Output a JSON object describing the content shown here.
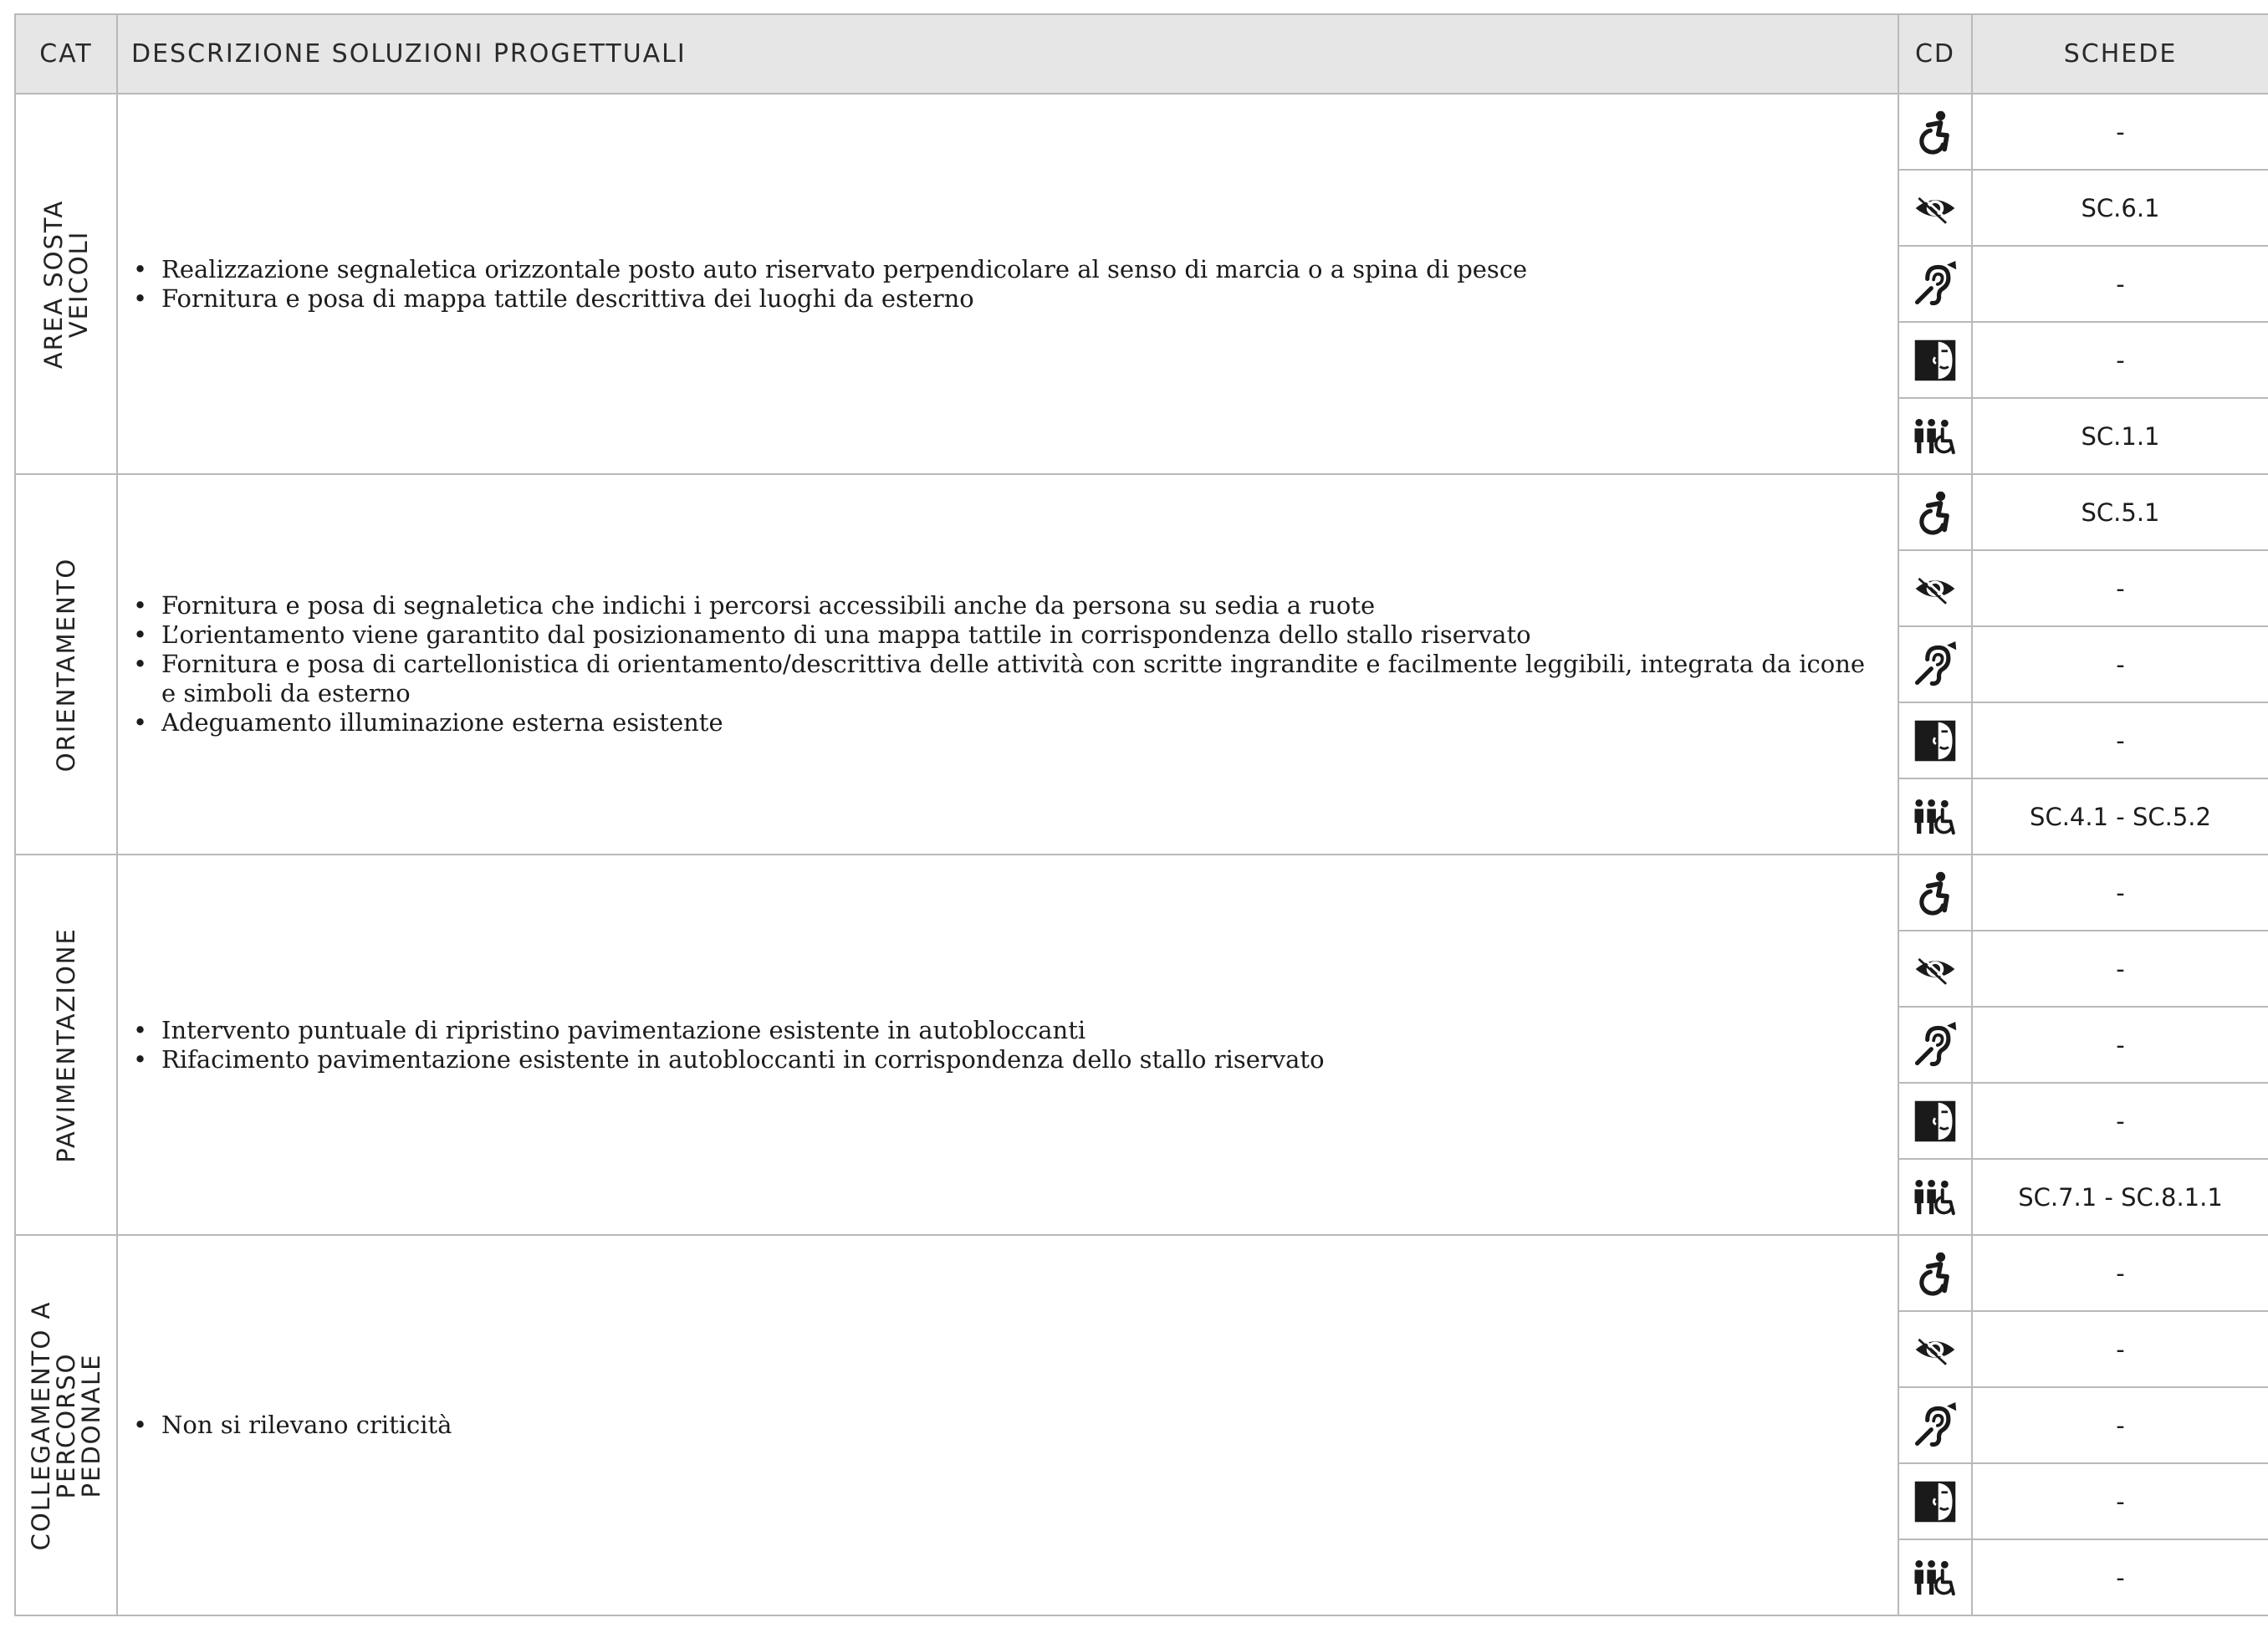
{
  "header": {
    "cat": "CAT",
    "desc": "DESCRIZIONE SOLUZIONI PROGETTUALI",
    "cd": "CD",
    "schede": "SCHEDE"
  },
  "sections": [
    {
      "category": "AREA SOSTA\nVEICOLI",
      "items": [
        "Realizzazione segnaletica orizzontale posto auto riservato perpendicolare al senso di marcia o a spina di pesce",
        "Fornitura e posa di mappa tattile descrittiva dei luoghi da esterno"
      ],
      "rows": [
        {
          "icon": "wheelchair-icon",
          "scheda": "-"
        },
        {
          "icon": "eye-icon",
          "scheda": "SC.6.1"
        },
        {
          "icon": "ear-icon",
          "scheda": "-"
        },
        {
          "icon": "face-icon",
          "scheda": "-"
        },
        {
          "icon": "people-icon",
          "scheda": "SC.1.1"
        }
      ]
    },
    {
      "category": "ORIENTAMENTO",
      "items": [
        "Fornitura e posa di segnaletica che indichi i percorsi accessibili anche da persona su sedia a ruote",
        "L’orientamento viene garantito dal posizionamento di una mappa tattile in corrispondenza dello stallo riservato",
        "Fornitura e posa di cartellonistica di orientamento/descrittiva delle attività con scritte ingrandite e facilmente leggibili, integrata da icone e simboli da esterno",
        "Adeguamento illuminazione esterna esistente"
      ],
      "rows": [
        {
          "icon": "wheelchair-icon",
          "scheda": "SC.5.1"
        },
        {
          "icon": "eye-icon",
          "scheda": "-"
        },
        {
          "icon": "ear-icon",
          "scheda": "-"
        },
        {
          "icon": "face-icon",
          "scheda": "-"
        },
        {
          "icon": "people-icon",
          "scheda": "SC.4.1 - SC.5.2"
        }
      ]
    },
    {
      "category": "PAVIMENTAZIONE",
      "items": [
        "Intervento puntuale di ripristino pavimentazione esistente in autobloccanti",
        "Rifacimento pavimentazione esistente in autobloccanti in corrispondenza dello stallo riservato"
      ],
      "rows": [
        {
          "icon": "wheelchair-icon",
          "scheda": "-"
        },
        {
          "icon": "eye-icon",
          "scheda": "-"
        },
        {
          "icon": "ear-icon",
          "scheda": "-"
        },
        {
          "icon": "face-icon",
          "scheda": "-"
        },
        {
          "icon": "people-icon",
          "scheda": "SC.7.1 - SC.8.1.1"
        }
      ]
    },
    {
      "category": "COLLEGAMENTO A\nPERCORSO\nPEDONALE",
      "items": [
        "Non si rilevano criticità"
      ],
      "rows": [
        {
          "icon": "wheelchair-icon",
          "scheda": "-"
        },
        {
          "icon": "eye-icon",
          "scheda": "-"
        },
        {
          "icon": "ear-icon",
          "scheda": "-"
        },
        {
          "icon": "face-icon",
          "scheda": "-"
        },
        {
          "icon": "people-icon",
          "scheda": "-"
        }
      ]
    }
  ]
}
